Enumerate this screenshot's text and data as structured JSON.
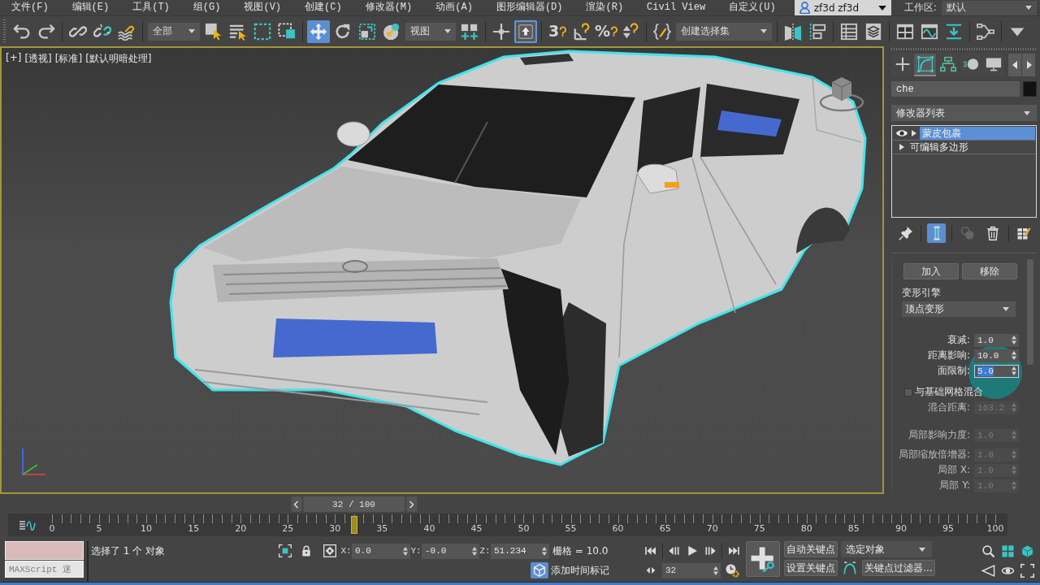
{
  "menu_bar": {
    "items": [
      "文件(F)",
      "编辑(E)",
      "工具(T)",
      "组(G)",
      "视图(V)",
      "创建(C)",
      "修改器(M)",
      "动画(A)",
      "图形编辑器(D)",
      "渲染(R)",
      "Civil View",
      "自定义(U)"
    ],
    "user": "zf3d zf3d",
    "workspace_label": "工作区:",
    "workspace": "默认"
  },
  "main_toolbar": [
    [
      {
        "kind": "tool",
        "selected": false
      },
      {
        "kind": "tool",
        "selected": false
      }
    ],
    [
      {
        "kind": "tool",
        "selected": false
      },
      {
        "kind": "tool",
        "selected": false
      },
      {
        "kind": "tool",
        "selected": false
      }
    ],
    [
      {
        "kind": "dropdown",
        "value": "全部"
      },
      {
        "kind": "tool",
        "selected": false
      },
      {
        "kind": "tool",
        "selected": false
      },
      {
        "kind": "tool",
        "selected": false
      },
      {
        "kind": "tool",
        "selected": false
      }
    ],
    [
      {
        "kind": "tool",
        "selected": true
      },
      {
        "kind": "tool",
        "selected": false
      },
      {
        "kind": "tool",
        "selected": false
      },
      {
        "kind": "tool",
        "selected": false
      },
      {
        "kind": "dropdown",
        "value": "视图"
      },
      {
        "kind": "tool",
        "selected": false
      }
    ],
    [
      {
        "kind": "tool",
        "selected": false
      },
      {
        "kind": "toggle",
        "on": true
      }
    ],
    [
      {
        "kind": "tool",
        "selected": false,
        "glyph": "3"
      },
      {
        "kind": "tool",
        "selected": false
      },
      {
        "kind": "tool",
        "selected": false,
        "glyph": "%"
      },
      {
        "kind": "tool",
        "selected": false
      }
    ],
    [
      {
        "kind": "tool",
        "selected": false
      },
      {
        "kind": "dropdown",
        "value": "创建选择集"
      }
    ],
    [
      {
        "kind": "tool",
        "selected": false
      },
      {
        "kind": "tool",
        "selected": false
      }
    ],
    [
      {
        "kind": "tool",
        "selected": false
      },
      {
        "kind": "tool",
        "selected": false
      }
    ],
    [
      {
        "kind": "tool",
        "selected": false
      },
      {
        "kind": "tool",
        "selected": false
      },
      {
        "kind": "tool",
        "selected": false
      }
    ],
    [
      {
        "kind": "tool",
        "selected": false
      }
    ],
    [
      {
        "kind": "tool",
        "selected": false
      }
    ]
  ],
  "viewport": {
    "labels": [
      "[+]",
      "[透视]",
      "[标准]",
      "[默认明暗处理]"
    ]
  },
  "command_panel": {
    "tabs": [
      {
        "selected": false
      },
      {
        "selected": true
      },
      {
        "selected": false
      },
      {
        "selected": false
      },
      {
        "selected": false
      }
    ],
    "object_name": "che",
    "modifier_list": "修改器列表",
    "stack": [
      {
        "kind": "modifier",
        "label": "蒙皮包裹",
        "selected": true
      },
      {
        "kind": "base_object",
        "label": "可编辑多边形",
        "selected": false
      }
    ],
    "stack_tools": [
      {
        "selected": false,
        "disabled": false
      },
      {
        "selected": true,
        "disabled": false
      },
      {
        "selected": false,
        "disabled": true
      },
      {
        "selected": false,
        "disabled": false
      },
      {
        "selected": false,
        "disabled": false
      }
    ],
    "rollout": {
      "buttons": [
        "加入",
        "移除"
      ],
      "engine_label": "变形引擎",
      "engine": "顶点变形",
      "groups": [
        [
          {
            "kind": "spinner",
            "label": "衰减:",
            "value": "1.0",
            "disabled": false,
            "focused": false
          },
          {
            "kind": "spinner",
            "label": "距离影响:",
            "value": "10.0",
            "disabled": false,
            "focused": false
          },
          {
            "kind": "spinner",
            "label": "面限制:",
            "value": "5.0",
            "disabled": false,
            "focused": true
          },
          {
            "kind": "checkbox",
            "label": "与基础网格混合",
            "checked": false
          },
          {
            "kind": "spinner",
            "label": "混合距离:",
            "value": "163.2",
            "disabled": true,
            "focused": false
          }
        ],
        [
          {
            "kind": "spinner",
            "label": "局部影响力度:",
            "value": "1.0",
            "disabled": true,
            "focused": false
          }
        ],
        [
          {
            "kind": "spinner",
            "label": "局部缩放倍增器:",
            "value": "1.0",
            "disabled": true,
            "focused": false
          },
          {
            "kind": "spinner",
            "label": "局部 X:",
            "value": "1.0",
            "disabled": true,
            "focused": false
          },
          {
            "kind": "spinner",
            "label": "局部 Y:",
            "value": "1.0",
            "disabled": true,
            "focused": false
          }
        ]
      ]
    }
  },
  "time_slider": {
    "position": "32 / 100",
    "level": 0.32
  },
  "timeline": {
    "labels": [
      "0",
      "5",
      "10",
      "15",
      "20",
      "25",
      "30",
      "35",
      "40",
      "45",
      "50",
      "55",
      "60",
      "65",
      "70",
      "75",
      "80",
      "85",
      "90",
      "95",
      "100"
    ]
  },
  "status": {
    "maxscript": "MAXScript 迷",
    "prompt": "选择了 1 个 对象",
    "coordinates": [
      {
        "axis": "X:",
        "value": "0.0"
      },
      {
        "axis": "Y:",
        "value": "-0.0"
      },
      {
        "axis": "Z:",
        "value": "51.234"
      }
    ],
    "grid": "栅格 = 10.0",
    "time_tag": "添加时间标记"
  },
  "playback": {
    "current_frame": "32"
  },
  "keys": {
    "auto_key": "自动关键点",
    "selection_set": "选定对象",
    "set_key": "设置关键点",
    "key_filters": "关键点过滤器..."
  }
}
